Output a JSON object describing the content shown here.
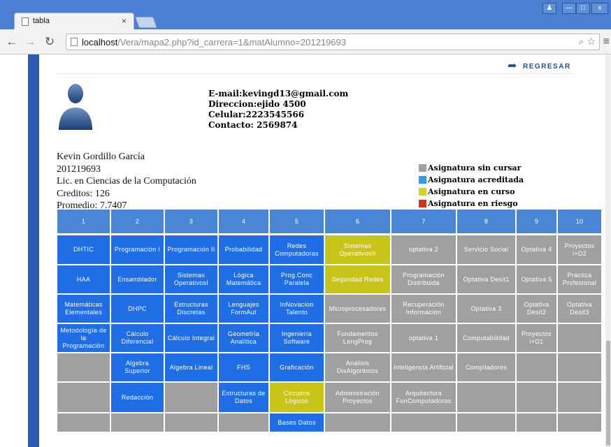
{
  "browser": {
    "tab_title": "tabla",
    "tab_close": "×",
    "url_host": "localhost",
    "url_path": "/Vera/mapa2.php?id_carrera=1&matAlumno=201219693",
    "win_controls": [
      "♟",
      "—",
      "□",
      "x"
    ]
  },
  "page": {
    "back_label": "REGRESAR",
    "contact": {
      "email": "E-mail:kevingd13@gmail.com",
      "address": "Direccion:ejido 4500",
      "phone": "Celular:2223545566",
      "contact": "Contacto: 2569874"
    },
    "student": {
      "name": "Kevin Gordillo García",
      "id": "201219693",
      "career": "Lic. en Ciencias de la Computación",
      "credits": "Creditos: 126",
      "average": "Promedio: 7.7407"
    },
    "legend": [
      {
        "label": "Asignatura sin cursar",
        "color": "#a0a0a0"
      },
      {
        "label": "Asignatura acreditada",
        "color": "#2e9be6"
      },
      {
        "label": "Asignatura en curso",
        "color": "#d8d516"
      },
      {
        "label": "Asignatura en riesgo",
        "color": "#d4321c"
      }
    ],
    "colors": {
      "head": "#4a86d6",
      "blue": "#1f6ee6",
      "gray": "#a0a0a0",
      "yellow": "#c8c419"
    },
    "grid": {
      "headers": [
        "1",
        "2",
        "3",
        "4",
        "5",
        "6",
        "7",
        "8",
        "9",
        "10"
      ],
      "rows": [
        [
          [
            "DHTIC",
            "blue"
          ],
          [
            "Programación I",
            "blue"
          ],
          [
            "Programación II",
            "blue"
          ],
          [
            "Probabilidad",
            "blue"
          ],
          [
            "Redes Computadoras",
            "blue"
          ],
          [
            "Sistemas OperativosII",
            "yellow"
          ],
          [
            "optativa 2",
            "gray"
          ],
          [
            "Servicio Social",
            "gray"
          ],
          [
            "Optativa 4",
            "gray"
          ],
          [
            "Proyectos i+D2",
            "gray"
          ]
        ],
        [
          [
            "HAA",
            "blue"
          ],
          [
            "Ensamblador",
            "blue"
          ],
          [
            "Sistemas OperativosI",
            "blue"
          ],
          [
            "Lógica Matemática",
            "blue"
          ],
          [
            "Prog.Conc Paralela",
            "blue"
          ],
          [
            "Seguridad Redes",
            "yellow"
          ],
          [
            "Programación Distribuida",
            "gray"
          ],
          [
            "Optativa Desit1",
            "gray"
          ],
          [
            "Optativa 5",
            "gray"
          ],
          [
            "Práctica Profesional",
            "gray"
          ]
        ],
        [
          [
            "Matemáticas Elementales",
            "blue"
          ],
          [
            "DHPC",
            "blue"
          ],
          [
            "Estructuras Discretas",
            "blue"
          ],
          [
            "Lenguajes FormAut",
            "blue"
          ],
          [
            "InNovacion Talento",
            "blue"
          ],
          [
            "Microprocesadores",
            "gray"
          ],
          [
            "Recuperación Información",
            "gray"
          ],
          [
            "Optativa 3",
            "gray"
          ],
          [
            "Optativa Desit2",
            "gray"
          ],
          [
            "Optativa Desit3",
            "gray"
          ]
        ],
        [
          [
            "Metodología de la Programación",
            "blue"
          ],
          [
            "Cálculo Diferencial",
            "blue"
          ],
          [
            "Cálculo Integral",
            "blue"
          ],
          [
            "Geometría Analítica",
            "blue"
          ],
          [
            "Ingeniería Software",
            "blue"
          ],
          [
            "Fundamentos LengProg",
            "gray"
          ],
          [
            "optativa 1",
            "gray"
          ],
          [
            "Computabilidad",
            "gray"
          ],
          [
            "Proyectos i+D1",
            "gray"
          ],
          [
            "",
            "gray"
          ]
        ],
        [
          [
            "",
            "gray"
          ],
          [
            "Algebra Superior",
            "blue"
          ],
          [
            "Algebra Lineal",
            "blue"
          ],
          [
            "FHS",
            "blue"
          ],
          [
            "Graficación",
            "blue"
          ],
          [
            "Análisis DisAlgoritmos",
            "gray"
          ],
          [
            "Inteligencia Artificial",
            "gray"
          ],
          [
            "Compiladores",
            "gray"
          ],
          [
            "",
            "gray"
          ],
          [
            "",
            "gray"
          ]
        ],
        [
          [
            "",
            "gray"
          ],
          [
            "Redacción",
            "blue"
          ],
          [
            "",
            "gray"
          ],
          [
            "Estructuras de Datos",
            "blue"
          ],
          [
            "Circuitos Lógicos",
            "yellow"
          ],
          [
            "Administración Proyectos",
            "gray"
          ],
          [
            "Arquitectura FunComputadoras",
            "gray"
          ],
          [
            "",
            "gray"
          ],
          [
            "",
            "gray"
          ],
          [
            "",
            "gray"
          ]
        ],
        [
          [
            "",
            "gray"
          ],
          [
            "",
            "gray"
          ],
          [
            "",
            "gray"
          ],
          [
            "",
            "gray"
          ],
          [
            "Bases Datos",
            "blue"
          ],
          [
            "",
            "gray"
          ],
          [
            "",
            "gray"
          ],
          [
            "",
            "gray"
          ],
          [
            "",
            "gray"
          ],
          [
            "",
            "gray"
          ]
        ]
      ]
    }
  }
}
